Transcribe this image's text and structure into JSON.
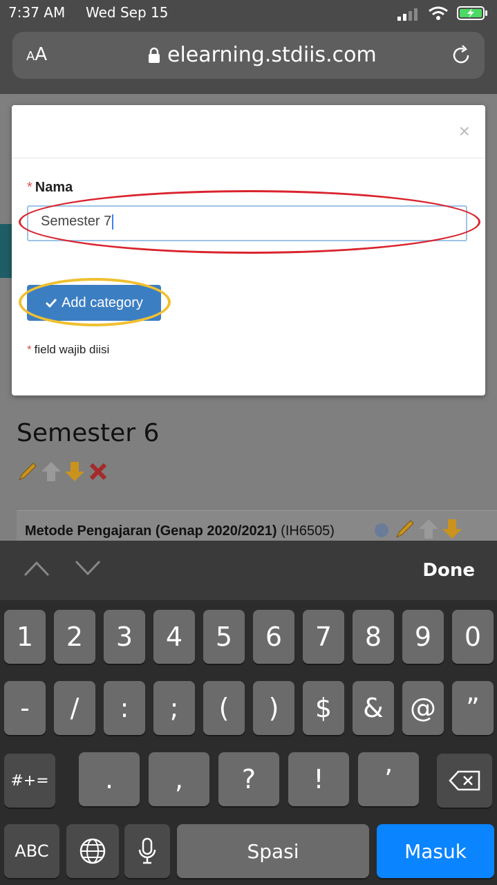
{
  "status_bar": {
    "time": "7:37 AM",
    "date": "Wed Sep 15"
  },
  "browser": {
    "aa_label_small": "A",
    "aa_label_large": "A",
    "url": "elearning.stdiis.com"
  },
  "modal": {
    "field_label": "Nama",
    "required_mark": "*",
    "input_value": "Semester 7",
    "submit_label": "Add category",
    "required_note": "field wajib diisi",
    "close_symbol": "×"
  },
  "page": {
    "section_title": "Semester 6",
    "course": {
      "name": "Metode Pengajaran (Genap 2020/2021)",
      "code": "(IH6505)"
    }
  },
  "keyboard": {
    "done_label": "Done",
    "row1": [
      "1",
      "2",
      "3",
      "4",
      "5",
      "6",
      "7",
      "8",
      "9",
      "0"
    ],
    "row2": [
      "-",
      "/",
      ":",
      ";",
      "(",
      ")",
      "$",
      "&",
      "@",
      "”"
    ],
    "row3_mode": "#+=",
    "row3": [
      ".",
      ",",
      "?",
      "!",
      "’"
    ],
    "abc_label": "ABC",
    "space_label": "Spasi",
    "return_label": "Masuk"
  },
  "colors": {
    "button_blue": "#3c7ec2",
    "oval_red": "#d9242e",
    "oval_yellow": "#f0c030",
    "return_blue": "#0a84ff"
  }
}
